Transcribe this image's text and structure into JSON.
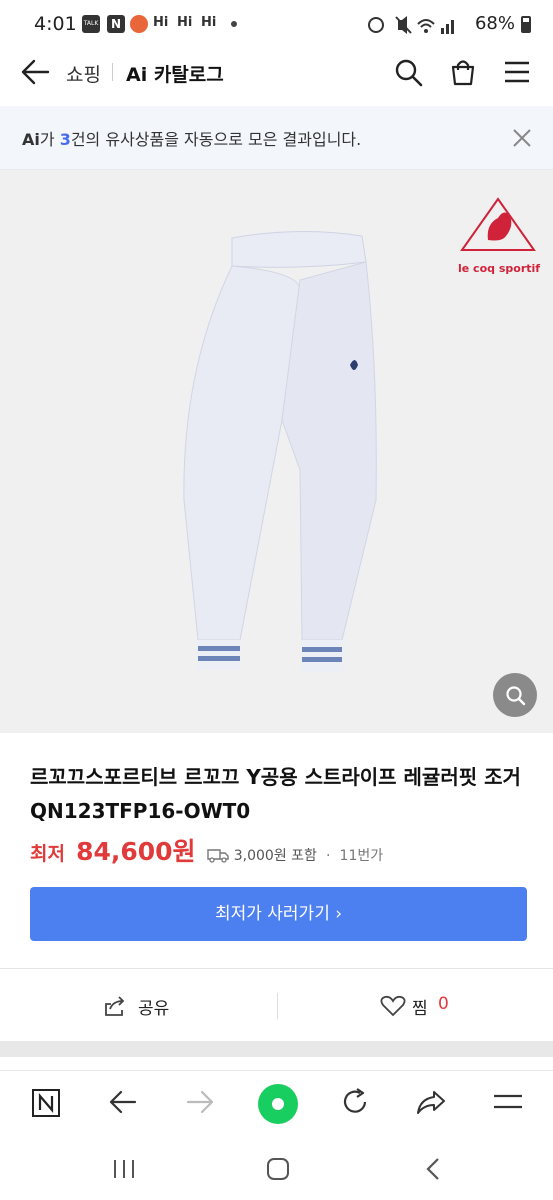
{
  "status_bar": {
    "time": "4:01",
    "notif_icons": [
      "TALK",
      "N",
      "Hi",
      "Hi",
      "Hi"
    ],
    "battery": "68%"
  },
  "header": {
    "breadcrumb_parent": "쇼핑",
    "title": "Ai 카탈로그"
  },
  "banner": {
    "prefix": "Ai",
    "text_a": "가 ",
    "count": "3",
    "text_b": "건의 유사상품을 자동으로 모은 결과입니다."
  },
  "product": {
    "brand_logo_text": "le coq sportif",
    "title": "르꼬끄스포르티브 르꼬끄 Y공용 스트라이프 레귤러핏 조거 QN123TFP16-OWT0",
    "price_label": "최저",
    "price": "84,600원",
    "shipping": "3,000원 포함",
    "sellers": "11번가",
    "buy_button": "최저가 사러가기 ›"
  },
  "actions": {
    "share": "공유",
    "wish": "찜",
    "wish_count": "0"
  },
  "colors": {
    "accent": "#4c7ff0",
    "price": "#e03a3a",
    "banner_bg": "#f3f6fb",
    "active_green": "#19ce60"
  },
  "icons": [
    "back-arrow-icon",
    "search-icon",
    "cart-bag-icon",
    "menu-icon",
    "close-icon",
    "zoom-icon",
    "share-icon",
    "heart-icon",
    "naver-n-icon",
    "back-icon",
    "forward-icon",
    "home-dot-icon",
    "refresh-icon",
    "share-arrow-icon",
    "hamburger-icon"
  ]
}
